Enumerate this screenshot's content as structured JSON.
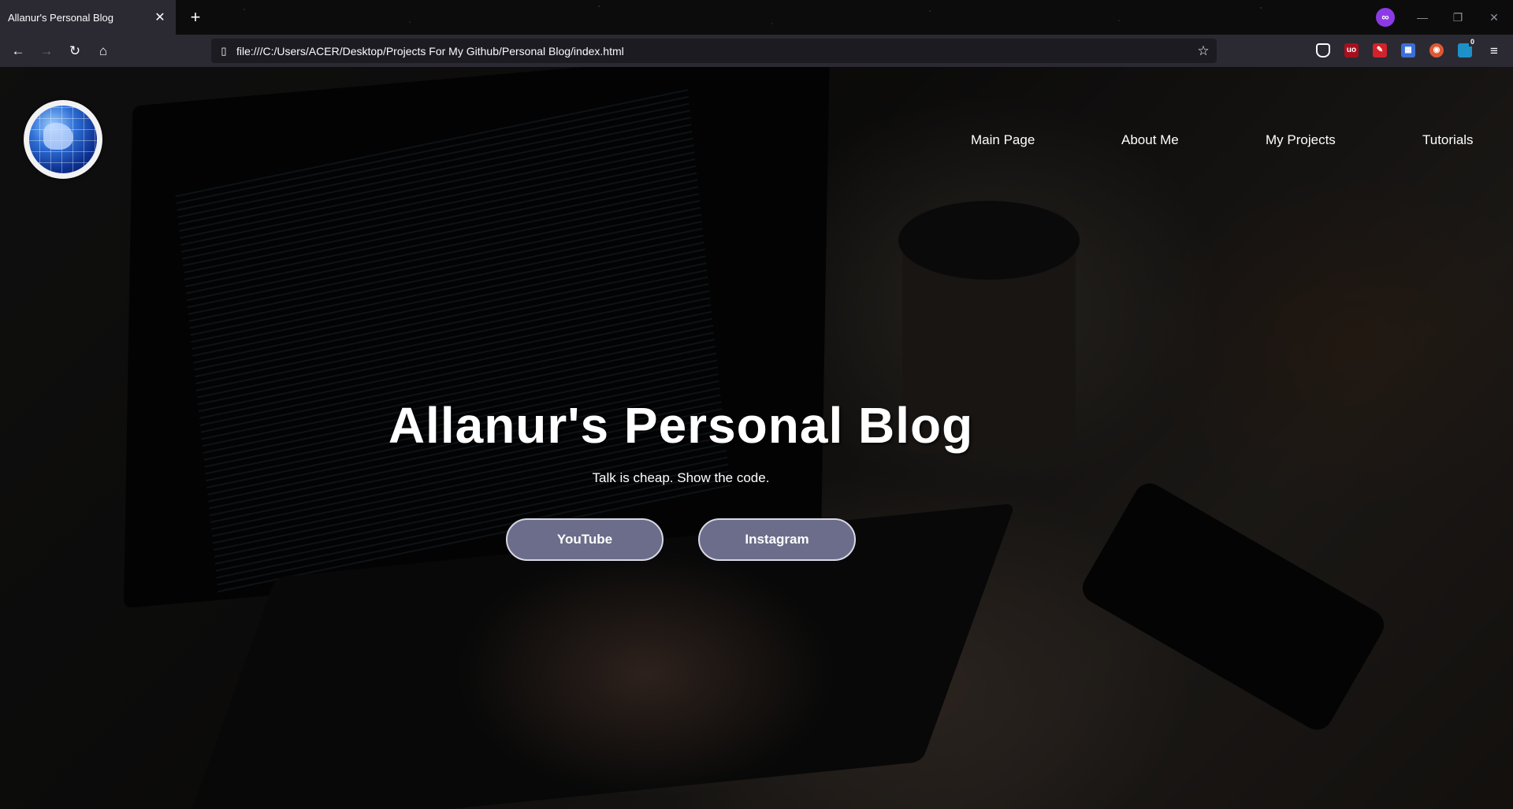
{
  "browser": {
    "tab_title": "Allanur's Personal Blog",
    "tab_close_icon": "✕",
    "new_tab_icon": "+",
    "url": "file:///C:/Users/ACER/Desktop/Projects For My Github/Personal Blog/index.html",
    "extension_badge": "0"
  },
  "site": {
    "nav": [
      "Main Page",
      "About Me",
      "My Projects",
      "Tutorials"
    ],
    "title": "Allanur's Personal Blog",
    "subtitle": "Talk is cheap. Show the code.",
    "buttons": [
      "YouTube",
      "Instagram"
    ]
  },
  "colors": {
    "button_bg": "#6b6d8a",
    "chrome_bg": "#2b2a33",
    "private_accent": "#8c3ae6"
  }
}
